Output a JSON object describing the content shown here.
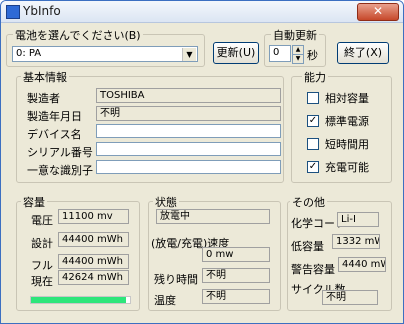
{
  "window": {
    "title": "YbInfo",
    "close_label": "✕"
  },
  "battery_select": {
    "label": "電池を選んでください(B)",
    "value": "0: PA"
  },
  "update_button": "更新(U)",
  "auto_update": {
    "label": "自動更新",
    "value": "0",
    "unit": "秒"
  },
  "exit_button": "終了(X)",
  "basic_info": {
    "legend": "基本情報",
    "manufacturer_label": "製造者",
    "manufacturer_value": "TOSHIBA",
    "date_label": "製造年月日",
    "date_value": "不明",
    "device_label": "デバイス名",
    "device_value": "",
    "serial_label": "シリアル番号",
    "serial_value": "",
    "unique_label": "一意な識別子",
    "unique_value": ""
  },
  "capability": {
    "legend": "能力",
    "items": [
      {
        "label": "相対容量",
        "checked": false
      },
      {
        "label": "標準電源",
        "checked": true
      },
      {
        "label": "短時間用",
        "checked": false
      },
      {
        "label": "充電可能",
        "checked": true
      }
    ]
  },
  "capacity": {
    "legend": "容量",
    "voltage_label": "電圧",
    "voltage_value": "11100 mv",
    "design_label": "設計",
    "design_value": "44400 mWh",
    "full_label": "フル",
    "full_value": "44400 mWh",
    "current_label": "現在",
    "current_value": "42624 mWh",
    "level": 0.96
  },
  "status": {
    "legend": "状態",
    "state_value": "放電中",
    "rate_label": "(放電/充電)速度",
    "rate_value": "0 mw",
    "remaining_label": "残り時間",
    "remaining_value": "不明",
    "temp_label": "温度",
    "temp_value": "不明"
  },
  "other": {
    "legend": "その他",
    "chem_label": "化学コード",
    "chem_value": "Li-I",
    "low_label": "低容量",
    "low_value": "1332 mWh",
    "warn_label": "警告容量",
    "warn_value": "4440 mWh",
    "cycle_label": "サイクル数",
    "cycle_value": "不明"
  },
  "colors": {
    "progress": "#2ee67a",
    "title_bg": "#dbe5f3"
  }
}
